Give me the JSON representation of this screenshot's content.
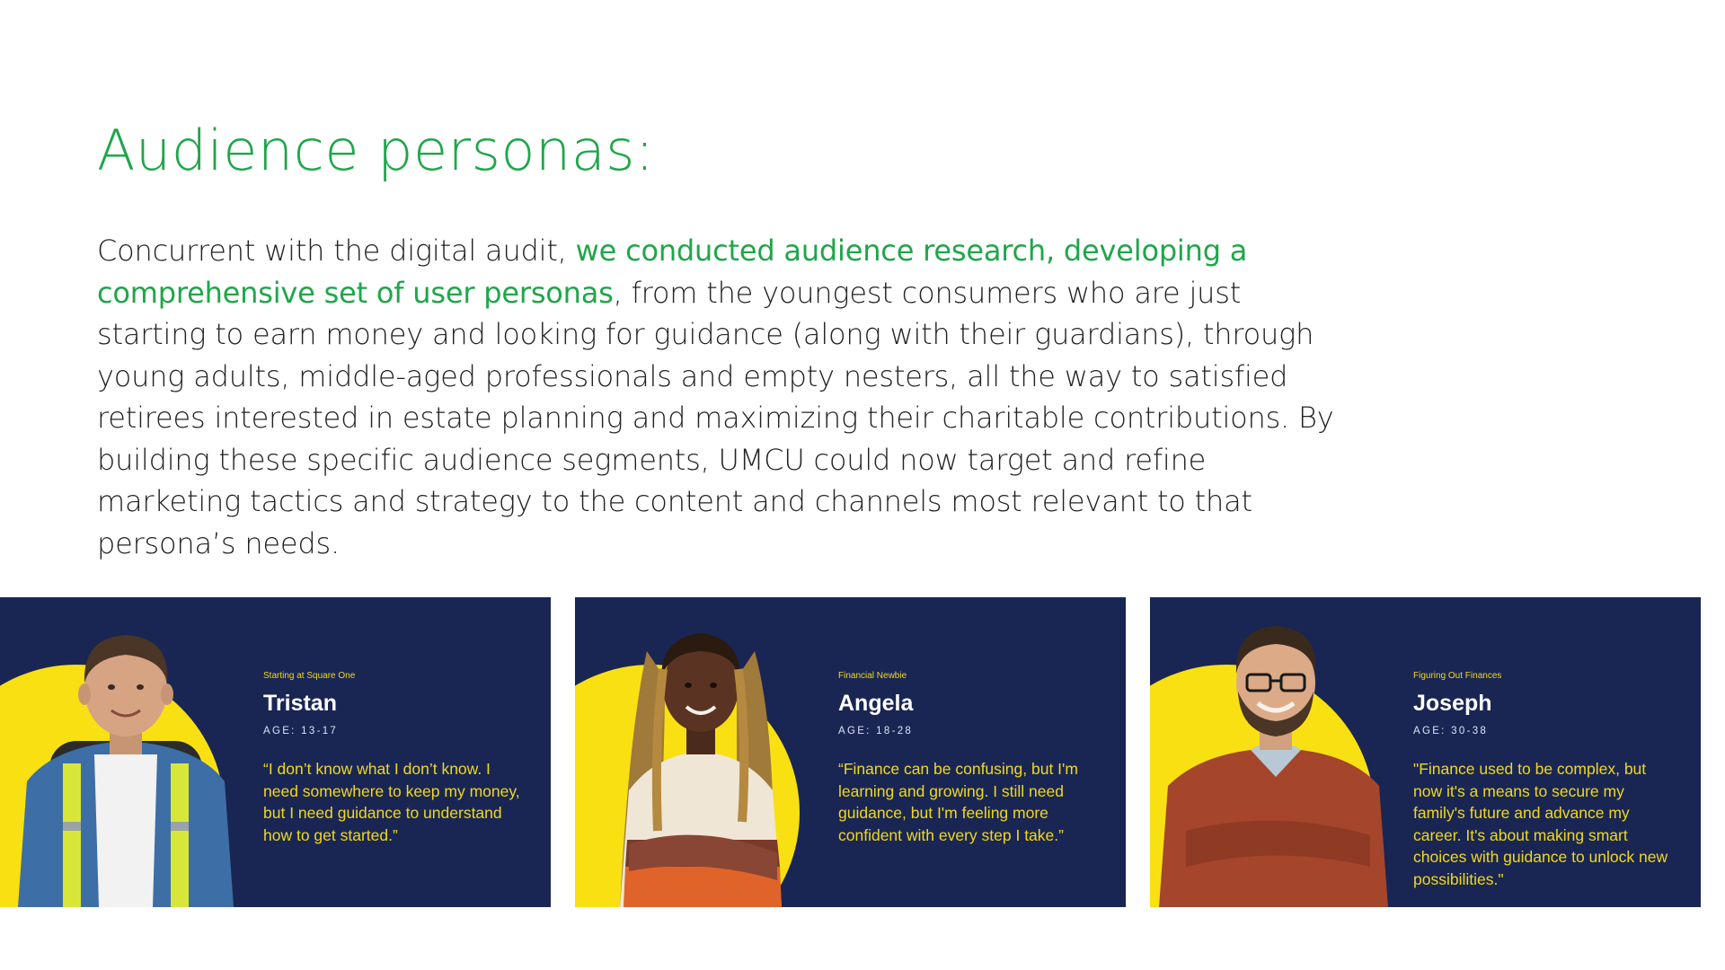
{
  "page": {
    "title": "Audience personas:",
    "intro": {
      "part1": "Concurrent with the digital audit, ",
      "highlight": "we conducted audience research, developing a comprehensive set of user personas",
      "part2": ", from the youngest consumers who are just starting to earn money and looking for guidance (along with their guardians), through young adults, middle-aged professionals and empty nesters, all the way to satisfied retirees interested in estate planning and maximizing their charitable contributions. By building these specific audience segments, UMCU could now target and refine marketing tactics and strategy to the content and channels most relevant to that persona’s needs."
    }
  },
  "colors": {
    "accent_green": "#1fa64a",
    "card_navy": "#192654",
    "persona_yellow": "#f9e013",
    "quote_yellow": "#f1d81a"
  },
  "personas": [
    {
      "eyebrow": "Starting at Square One",
      "name": "Tristan",
      "age": "AGE: 13-17",
      "quote": "“I don’t know what I don’t know. I need somewhere to keep my money, but I need guidance to understand how to get started.”",
      "photo_icon": "teen-boy-photo"
    },
    {
      "eyebrow": "Financial Newbie",
      "name": "Angela",
      "age": "AGE: 18-28",
      "quote": "“Finance can be confusing, but I'm learning and growing. I still need guidance, but I'm feeling more confident with every step I take.”",
      "photo_icon": "young-woman-photo"
    },
    {
      "eyebrow": "Figuring Out Finances",
      "name": "Joseph",
      "age": "AGE: 30-38",
      "quote": "\"Finance used to be complex, but now it's a means to secure my family's future and advance my career. It's about making smart choices with guidance to unlock new possibilities.\"",
      "photo_icon": "man-glasses-photo"
    }
  ]
}
